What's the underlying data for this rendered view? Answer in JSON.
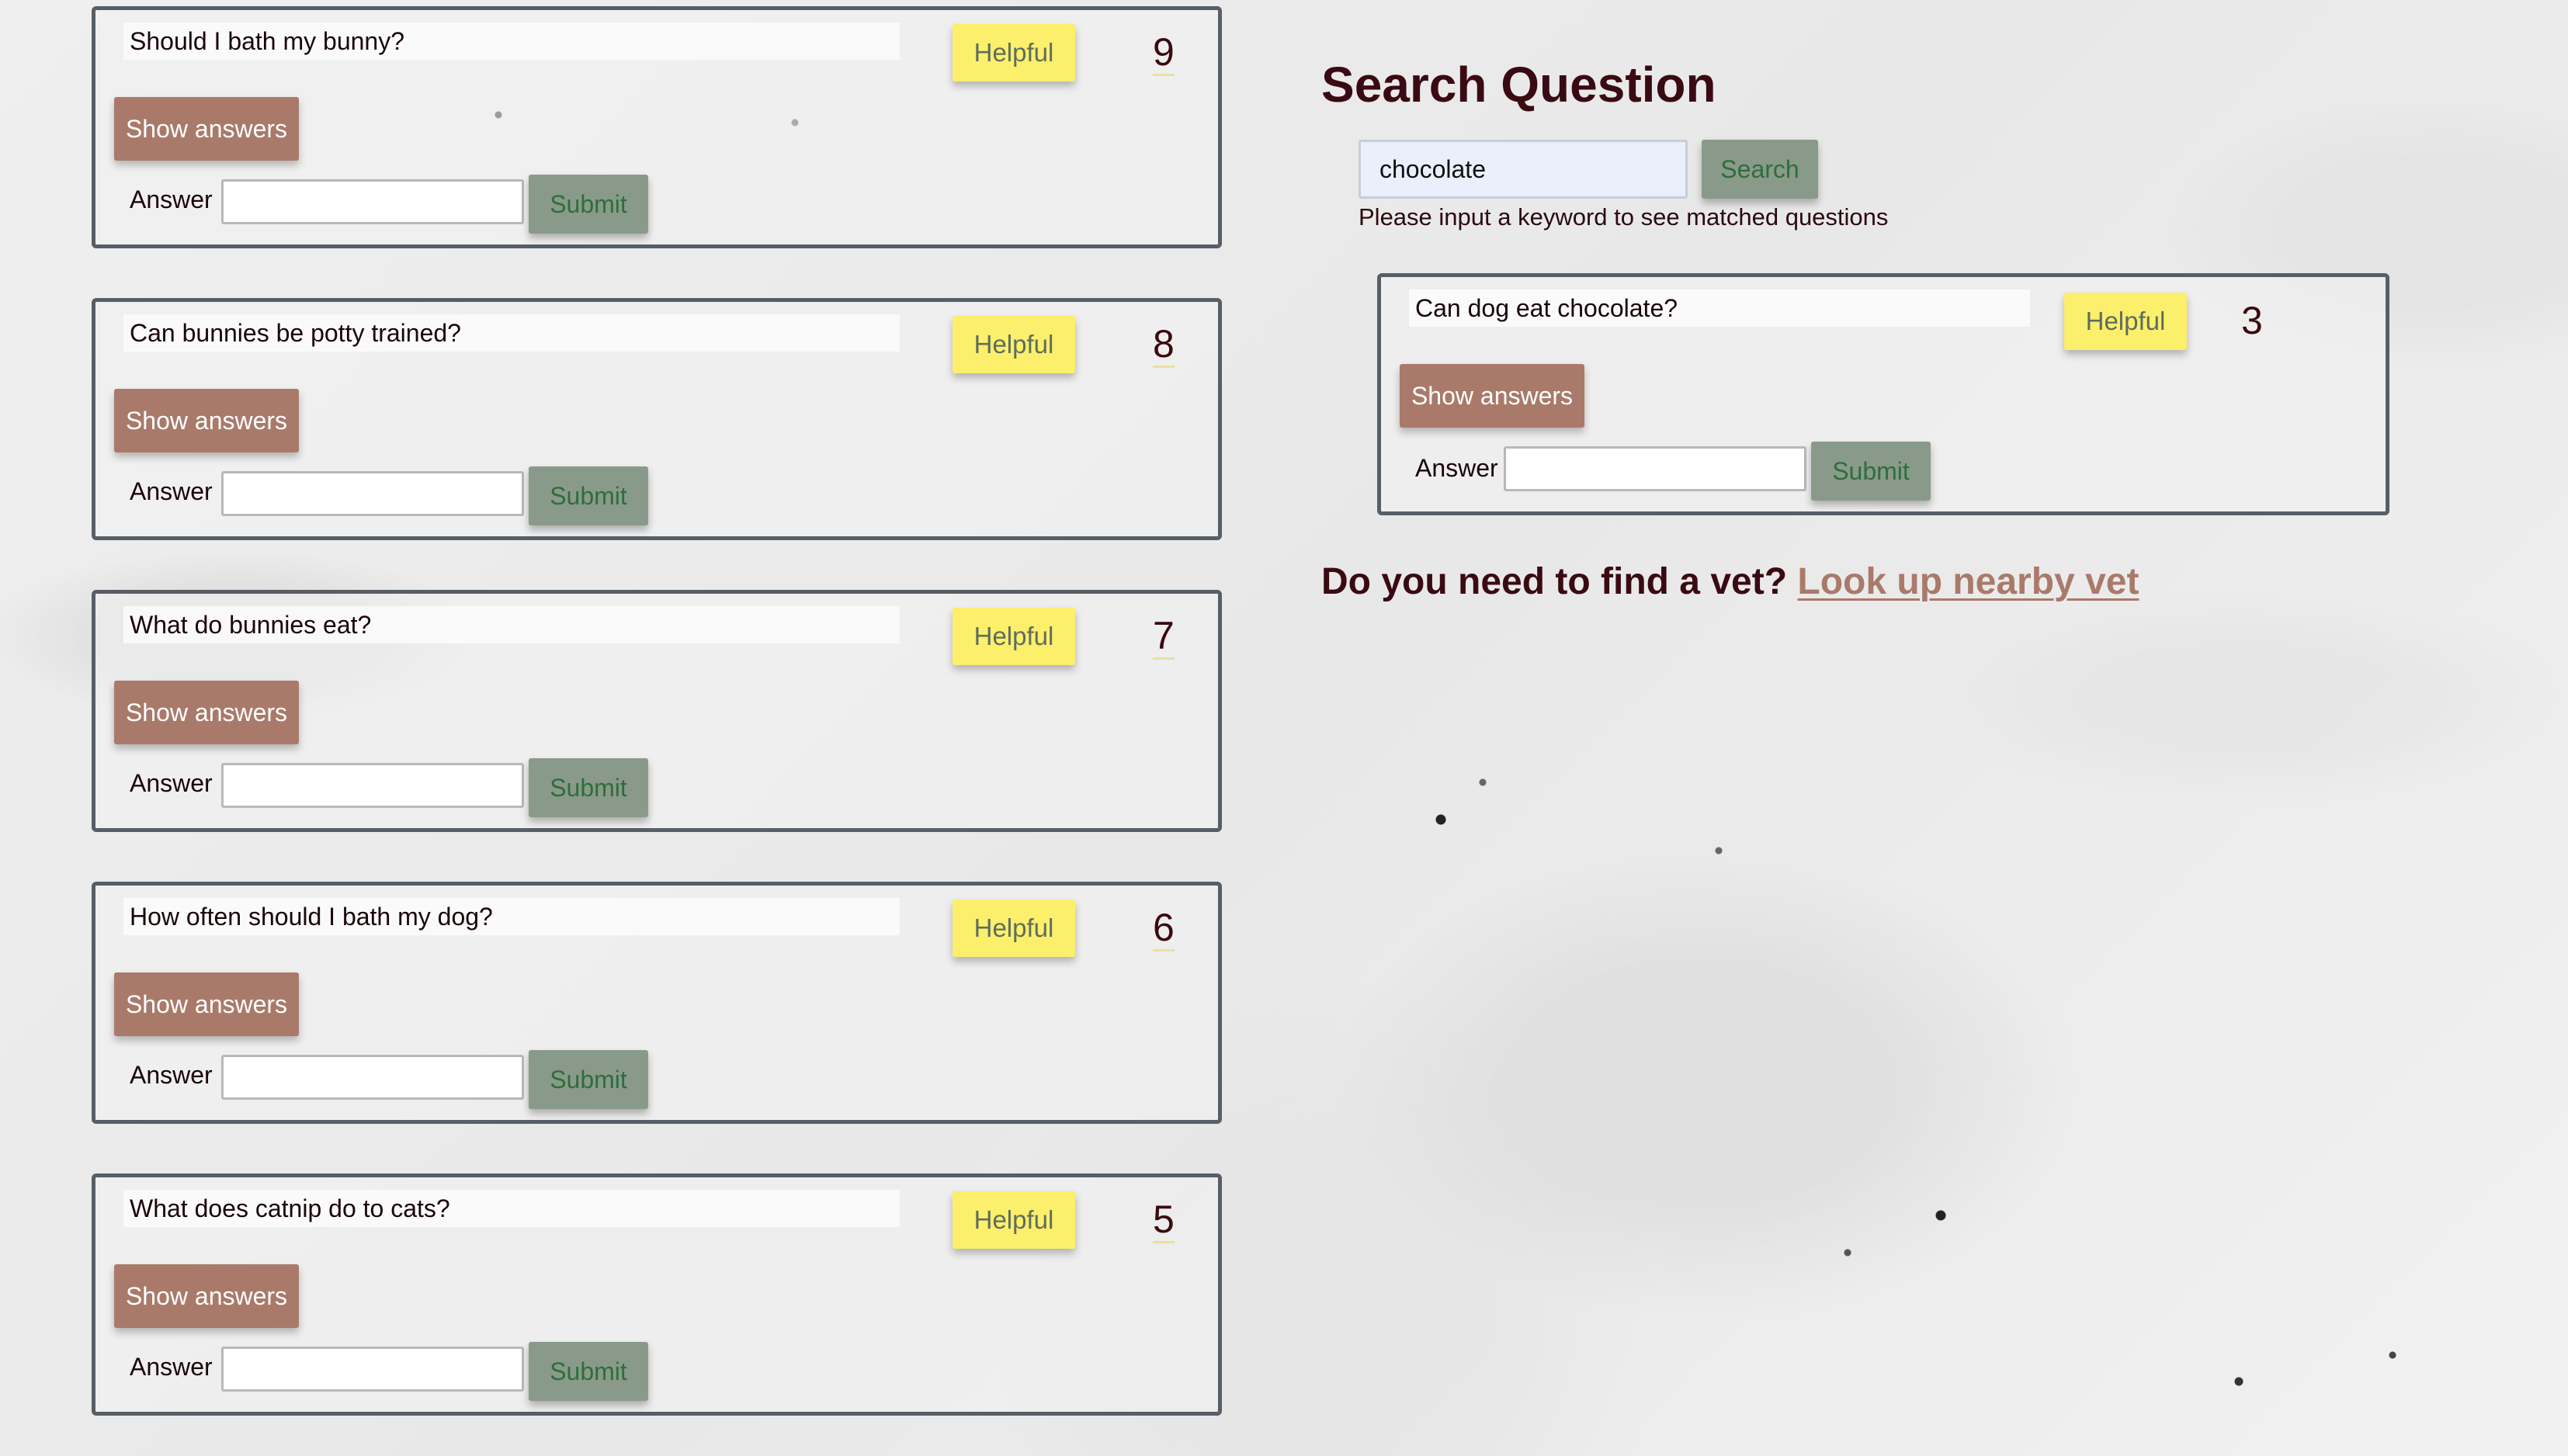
{
  "questions": [
    {
      "title": "Should I bath my bunny?",
      "helpful_label": "Helpful",
      "count": "9",
      "show_answers_label": "Show answers",
      "answer_label": "Answer",
      "submit_label": "Submit"
    },
    {
      "title": "Can bunnies be potty trained?",
      "helpful_label": "Helpful",
      "count": "8",
      "show_answers_label": "Show answers",
      "answer_label": "Answer",
      "submit_label": "Submit"
    },
    {
      "title": "What do bunnies eat?",
      "helpful_label": "Helpful",
      "count": "7",
      "show_answers_label": "Show answers",
      "answer_label": "Answer",
      "submit_label": "Submit"
    },
    {
      "title": "How often should I bath my dog?",
      "helpful_label": "Helpful",
      "count": "6",
      "show_answers_label": "Show answers",
      "answer_label": "Answer",
      "submit_label": "Submit"
    },
    {
      "title": "What does catnip do to cats?",
      "helpful_label": "Helpful",
      "count": "5",
      "show_answers_label": "Show answers",
      "answer_label": "Answer",
      "submit_label": "Submit"
    }
  ],
  "search": {
    "heading": "Search Question",
    "value": "chocolate",
    "button_label": "Search",
    "hint": "Please input a keyword to see matched questions"
  },
  "search_results": [
    {
      "title": "Can dog eat chocolate?",
      "helpful_label": "Helpful",
      "count": "3",
      "show_answers_label": "Show answers",
      "answer_label": "Answer",
      "submit_label": "Submit"
    }
  ],
  "vet": {
    "prompt": "Do you need to find a vet?",
    "link_label": "Look up nearby vet"
  },
  "colors": {
    "helpful": "#fbef6b",
    "show_answers": "#a97a6a",
    "submit": "#8a9a8a",
    "heading": "#3a0a12"
  }
}
